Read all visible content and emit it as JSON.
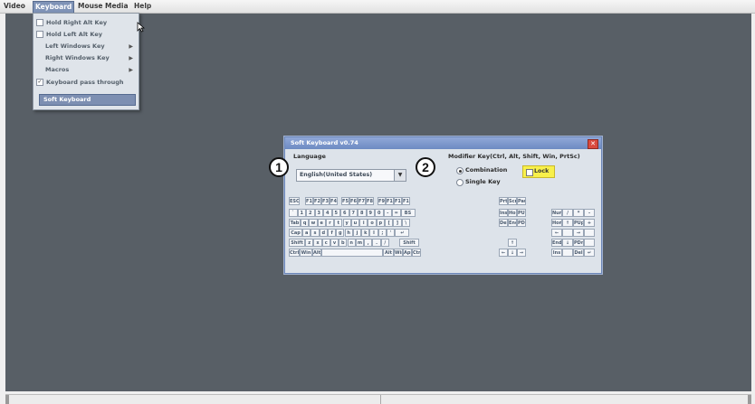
{
  "menubar": {
    "items": [
      {
        "label": "Video"
      },
      {
        "label": "Keyboard"
      },
      {
        "label": "Mouse"
      },
      {
        "label": "Media"
      },
      {
        "label": "Help"
      }
    ]
  },
  "keyboard_menu": {
    "items": [
      {
        "label": "Hold Right Alt Key",
        "checkbox": true,
        "checked": false
      },
      {
        "label": "Hold Left Alt Key",
        "checkbox": true,
        "checked": false
      },
      {
        "label": "Left Windows Key",
        "submenu": true
      },
      {
        "label": "Right Windows Key",
        "submenu": true
      },
      {
        "label": "Macros",
        "submenu": true
      },
      {
        "label": "Keyboard pass through",
        "checkbox": true,
        "checked": true
      },
      {
        "label": "Soft Keyboard",
        "selected": true
      }
    ]
  },
  "soft_keyboard": {
    "title": "Soft Keyboard v0.74",
    "language_label": "Language",
    "language_value": "English(United States)",
    "modifier_label": "Modifier Key(Ctrl, Alt, Shift, Win, PrtSc)",
    "combination_label": "Combination",
    "single_key_label": "Single Key",
    "lock_label": "Lock",
    "close_glyph": "✕"
  },
  "callouts": [
    "1",
    "2"
  ],
  "keys": {
    "row_fn": [
      "ESC",
      "F1",
      "F2",
      "F3",
      "F4",
      "F5",
      "F6",
      "F7",
      "F8",
      "F9",
      "F10",
      "F11",
      "F12"
    ],
    "row_num": [
      "`",
      "1",
      "2",
      "3",
      "4",
      "5",
      "6",
      "7",
      "8",
      "9",
      "0",
      "-",
      "=",
      "BS"
    ],
    "row_q": [
      "Tab",
      "q",
      "w",
      "e",
      "r",
      "t",
      "y",
      "u",
      "i",
      "o",
      "p",
      "[",
      "]",
      "\\"
    ],
    "row_a": [
      "Cap",
      "a",
      "s",
      "d",
      "f",
      "g",
      "h",
      "j",
      "k",
      "l",
      ";",
      "'",
      "↵"
    ],
    "row_z": [
      "Shift",
      "z",
      "x",
      "c",
      "v",
      "b",
      "n",
      "m",
      ",",
      ".",
      "/",
      "Shift"
    ],
    "row_sp": [
      "Ctrl",
      "Win",
      "Alt",
      "",
      "Alt",
      "Win",
      "App",
      "Ctrl"
    ],
    "nav_top": [
      "PrtSc",
      "ScrLk",
      "Paus"
    ],
    "nav_1": [
      "Ins",
      "Hom",
      "PUp"
    ],
    "nav_2": [
      "Del",
      "End",
      "PDn"
    ],
    "arrows": [
      "↑",
      "←",
      "↓",
      "→"
    ],
    "numpad": [
      [
        "NumL",
        "/",
        "*",
        "-"
      ],
      [
        "Hom",
        "↑",
        "PUp",
        "+"
      ],
      [
        "←",
        "",
        "→",
        ""
      ],
      [
        "End",
        "↓",
        "PDn",
        ""
      ],
      [
        "Ins",
        "",
        "Del",
        "↵"
      ]
    ]
  }
}
